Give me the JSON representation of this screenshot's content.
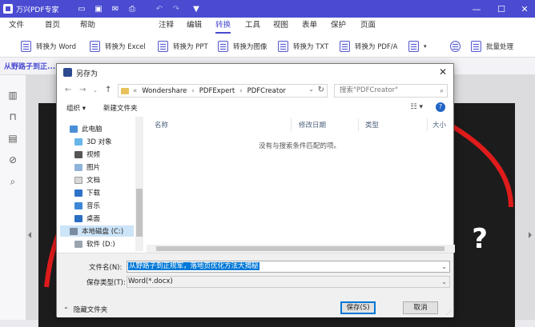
{
  "app": {
    "title": "万兴PDF专家"
  },
  "window_controls": {
    "minimize": "—",
    "maximize": "☐",
    "close": "✕"
  },
  "menu": [
    "文件",
    "首页",
    "帮助",
    "注释",
    "编辑",
    "转换",
    "工具",
    "视图",
    "表单",
    "保护",
    "页面"
  ],
  "active_menu": "转换",
  "toolbar": {
    "items": [
      "转换为 Word",
      "转换为 Excel",
      "转换为 PPT",
      "转换为图像",
      "转换为 TXT",
      "转换为 PDF/A",
      "批量处理"
    ]
  },
  "document_tab": "从野路子到正...",
  "dialog": {
    "title": "另存为",
    "breadcrumb": [
      "Wondershare",
      "PDFExpert",
      "PDFCreator"
    ],
    "search_placeholder": "搜索\"PDFCreator\"",
    "organize": "组织 ▾",
    "new_folder": "新建文件夹",
    "tree": [
      "此电脑",
      "3D 对象",
      "视频",
      "图片",
      "文档",
      "下载",
      "音乐",
      "桌面",
      "本地磁盘 (C:)",
      "软件 (D:)"
    ],
    "selected_tree_item": "本地磁盘 (C:)",
    "columns": [
      "名称",
      "修改日期",
      "类型",
      "大小"
    ],
    "empty_message": "没有与搜索条件匹配的项。",
    "filename_label": "文件名(N):",
    "filename_value": "从野路子到正规军，落地页优化方法大揭秘",
    "filetype_label": "保存类型(T):",
    "filetype_value": "Word(*.docx)",
    "hide_folders": "隐藏文件夹",
    "save_button": "保存(S)",
    "cancel_button": "取消"
  },
  "colors": {
    "accent": "#4a4bd1",
    "selection": "#0078d7",
    "tree_selection": "#cce4f7",
    "help": "#1f63c6"
  }
}
